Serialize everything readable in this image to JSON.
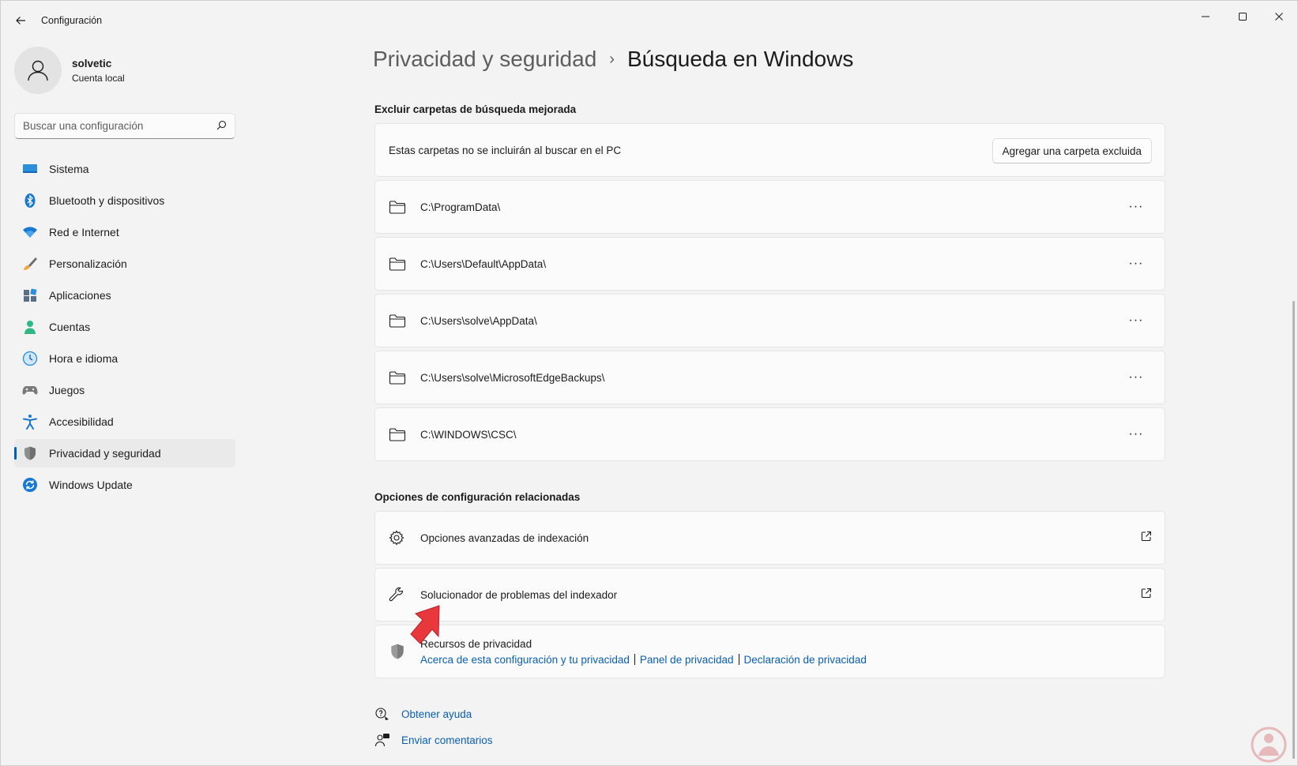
{
  "window": {
    "app_title": "Configuración"
  },
  "profile": {
    "name": "solvetic",
    "account_type": "Cuenta local"
  },
  "search": {
    "placeholder": "Buscar una configuración"
  },
  "sidebar": {
    "items": [
      {
        "label": "Sistema",
        "icon": "system-icon"
      },
      {
        "label": "Bluetooth y dispositivos",
        "icon": "bluetooth-icon"
      },
      {
        "label": "Red e Internet",
        "icon": "wifi-icon"
      },
      {
        "label": "Personalización",
        "icon": "brush-icon"
      },
      {
        "label": "Aplicaciones",
        "icon": "apps-icon"
      },
      {
        "label": "Cuentas",
        "icon": "account-icon"
      },
      {
        "label": "Hora e idioma",
        "icon": "clock-globe-icon"
      },
      {
        "label": "Juegos",
        "icon": "gamepad-icon"
      },
      {
        "label": "Accesibilidad",
        "icon": "accessibility-icon"
      },
      {
        "label": "Privacidad y seguridad",
        "icon": "shield-icon",
        "active": true
      },
      {
        "label": "Windows Update",
        "icon": "update-icon"
      }
    ]
  },
  "breadcrumb": {
    "parent": "Privacidad y seguridad",
    "separator": "›",
    "current": "Búsqueda en Windows"
  },
  "exclude_section": {
    "title": "Excluir carpetas de búsqueda mejorada",
    "description": "Estas carpetas no se incluirán al buscar en el PC",
    "add_button": "Agregar una carpeta excluida",
    "folders": [
      "C:\\ProgramData\\",
      "C:\\Users\\Default\\AppData\\",
      "C:\\Users\\solve\\AppData\\",
      "C:\\Users\\solve\\MicrosoftEdgeBackups\\",
      "C:\\WINDOWS\\CSC\\"
    ],
    "more_label": "···"
  },
  "related_section": {
    "title": "Opciones de configuración relacionadas",
    "advanced_indexing": "Opciones avanzadas de indexación",
    "troubleshooter": "Solucionador de problemas del indexador",
    "privacy_resources": {
      "title": "Recursos de privacidad",
      "links": [
        "Acerca de esta configuración y tu privacidad",
        "Panel de privacidad",
        "Declaración de privacidad"
      ]
    }
  },
  "help": {
    "get_help": "Obtener ayuda",
    "send_feedback": "Enviar comentarios"
  },
  "colors": {
    "accent": "#005fb8",
    "link": "#0a5fb4",
    "annotation_arrow": "#e8383d"
  }
}
